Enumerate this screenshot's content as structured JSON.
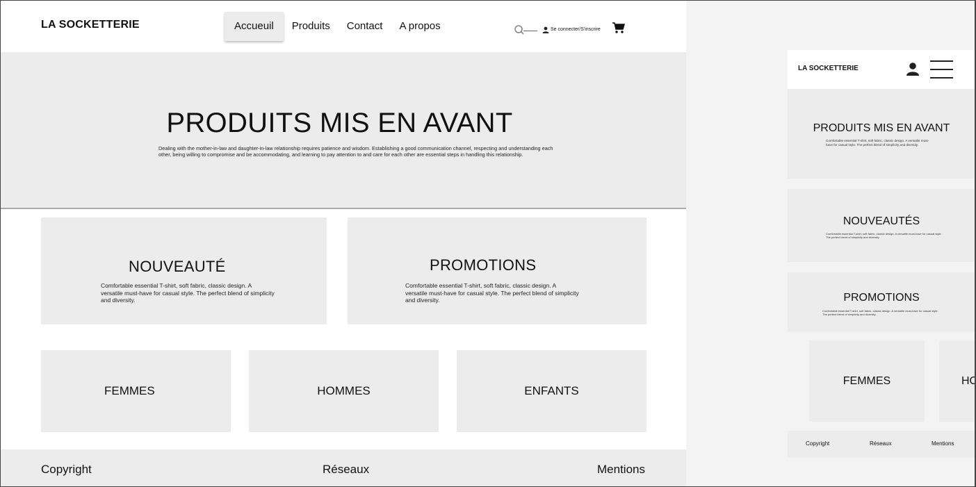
{
  "desktop": {
    "header": {
      "logo": "LA SOCKETTERIE",
      "nav": [
        {
          "label": "Accueuil",
          "active": true
        },
        {
          "label": "Produits",
          "active": false
        },
        {
          "label": "Contact",
          "active": false
        },
        {
          "label": "A propos",
          "active": false
        }
      ],
      "login_label": "Se connecter/S'inscrire"
    },
    "hero": {
      "title": "PRODUITS MIS EN AVANT",
      "description": "Dealing with the mother-in-law and daughter-in-law relationship requires patience and wisdom. Establishing a good communication channel, respecting and understanding each other, being willing to compromise and be accommodating, and learning to pay attention to and care for each other are essential steps in handling this relationship."
    },
    "cards": [
      {
        "title": "NOUVEAUTÉ",
        "description": "Comfortable essential T-shirt, soft fabric, classic design. A versatile must-have for casual style. The perfect blend of simplicity and diversity."
      },
      {
        "title": "PROMOTIONS",
        "description": "Comfortable essential T-shirt, soft fabric, classic design. A versatile must-have for casual style. The perfect blend of simplicity and diversity."
      }
    ],
    "categories": [
      "FEMMES",
      "HOMMES",
      "ENFANTS"
    ],
    "footer": {
      "copyright": "Copyright",
      "social": "Réseaux",
      "legal": "Mentions"
    }
  },
  "mobile": {
    "logo": "LA SOCKETTERIE",
    "hero": {
      "title": "PRODUITS MIS EN AVANT",
      "description": "Comfortable essential T-shirt, soft fabric, classic design. A versatile must-have for casual style. The perfect blend of simplicity and diversity."
    },
    "new": {
      "title": "NOUVEAUTÉS",
      "description": "Comfortable essential T-shirt, soft fabric, classic design. A versatile must-have for casual style. The perfect blend of simplicity and diversity."
    },
    "promotions": {
      "title": "PROMOTIONS",
      "description": "Comfortable essential T-shirt, soft fabric, classic design. A versatile must-have for casual style. The perfect blend of simplicity and diversity."
    },
    "categories": [
      "FEMMES",
      "HOMMES"
    ],
    "footer": {
      "copyright": "Copyright",
      "social": "Réseaux",
      "legal": "Mentions"
    }
  },
  "icons": {
    "search": "search-icon",
    "user": "user-icon",
    "cart": "cart-icon",
    "menu": "hamburger-menu-icon"
  },
  "colors": {
    "panel": "#ececec",
    "background": "#ffffff",
    "text": "#111111"
  }
}
